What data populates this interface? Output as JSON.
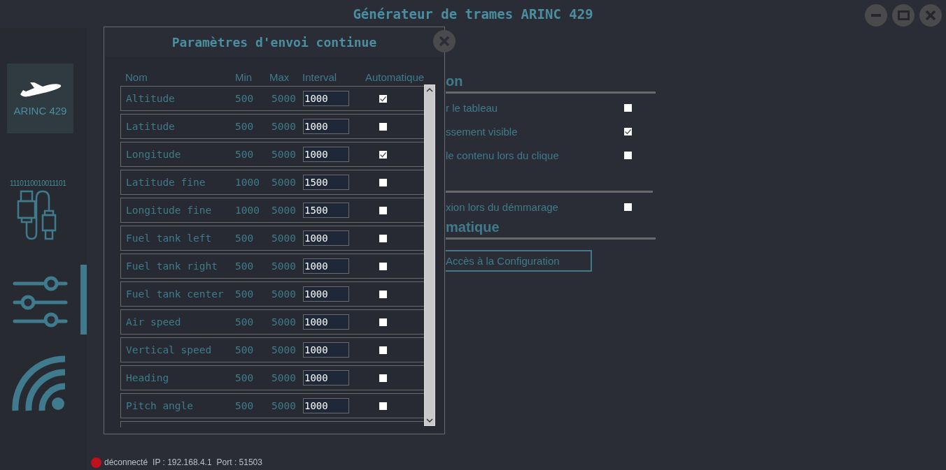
{
  "window": {
    "title": "Générateur de trames ARINC 429"
  },
  "sidebar": {
    "items": [
      {
        "kind": "logo",
        "label": "ARINC 429",
        "selected": false
      },
      {
        "kind": "usb",
        "label": "1110110010011101",
        "selected": false
      },
      {
        "kind": "settings",
        "selected": true
      },
      {
        "kind": "wireless",
        "selected": false
      }
    ]
  },
  "settings_panel": {
    "sections": [
      {
        "title": "on",
        "options": [
          {
            "label": "r le tableau",
            "checked": false
          },
          {
            "label": "ssement visible",
            "checked": true
          },
          {
            "label": "le contenu lors du clique",
            "checked": false
          }
        ]
      },
      {
        "options": [
          {
            "label": "xion lors du démmarage",
            "checked": false
          }
        ]
      },
      {
        "title": "matique",
        "button": "Accès à la Configuration"
      }
    ]
  },
  "dialog": {
    "title": "Paramètres d'envoi continue",
    "columns": [
      "Nom",
      "Min",
      "Max",
      "Interval",
      "Automatique"
    ],
    "rows": [
      {
        "name": "Altitude",
        "min": "500",
        "max": "5000",
        "interval": "1000",
        "auto": true
      },
      {
        "name": "Latitude",
        "min": "500",
        "max": "5000",
        "interval": "1000",
        "auto": false
      },
      {
        "name": "Longitude",
        "min": "500",
        "max": "5000",
        "interval": "1000",
        "auto": true
      },
      {
        "name": "Latitude fine",
        "min": "1000",
        "max": "5000",
        "interval": "1500",
        "auto": false
      },
      {
        "name": "Longitude fine",
        "min": "1000",
        "max": "5000",
        "interval": "1500",
        "auto": false
      },
      {
        "name": "Fuel tank left",
        "min": "500",
        "max": "5000",
        "interval": "1000",
        "auto": false
      },
      {
        "name": "Fuel tank right",
        "min": "500",
        "max": "5000",
        "interval": "1000",
        "auto": false
      },
      {
        "name": "Fuel tank center",
        "min": "500",
        "max": "5000",
        "interval": "1000",
        "auto": false
      },
      {
        "name": "Air speed",
        "min": "500",
        "max": "5000",
        "interval": "1000",
        "auto": false
      },
      {
        "name": "Vertical speed",
        "min": "500",
        "max": "5000",
        "interval": "1000",
        "auto": false
      },
      {
        "name": "Heading",
        "min": "500",
        "max": "5000",
        "interval": "1000",
        "auto": false
      },
      {
        "name": "Pitch angle",
        "min": "500",
        "max": "5000",
        "interval": "1000",
        "auto": false
      }
    ]
  },
  "status_bar": {
    "connected": false,
    "status": "déconnecté",
    "ip": "IP : 192.168.4.1",
    "port": "Port : 51503"
  }
}
